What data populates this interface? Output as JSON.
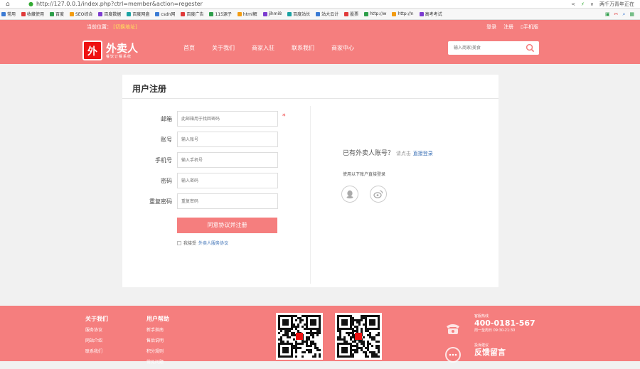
{
  "browser": {
    "url": "http://127.0.0.1/index.php?ctrl=member&action=regester",
    "right_text": "两千万青年正在",
    "bookmarks": [
      "常用",
      "收藏使用",
      "百度",
      "SEO综合",
      "百度数据",
      "百度网盘",
      "csdn网",
      "百度广告",
      "115源子",
      "html解",
      "jihmi8",
      "百度站长",
      "站大云计",
      "股票",
      "http://w",
      "http://n",
      "高考考试"
    ]
  },
  "header": {
    "location_label": "当前位置：",
    "location_city": "[切换地址]",
    "links": [
      "登录",
      "注册",
      "手机版"
    ],
    "logo_mark": "外",
    "logo_text": "外卖人",
    "logo_sub": "餐饮订餐系统",
    "nav": [
      "首页",
      "关于我们",
      "商家入驻",
      "联系我们",
      "商家中心"
    ],
    "search_placeholder": "输入商家/美食"
  },
  "register": {
    "title": "用户注册",
    "fields": [
      {
        "label": "邮箱",
        "placeholder": "此邮箱用于找回密码",
        "required": true
      },
      {
        "label": "账号",
        "placeholder": "输入账号",
        "required": false
      },
      {
        "label": "手机号",
        "placeholder": "输入手机号",
        "required": false
      },
      {
        "label": "密码",
        "placeholder": "输入密码",
        "required": false
      },
      {
        "label": "重复密码",
        "placeholder": "重复密码",
        "required": false
      }
    ],
    "required_mark": "*",
    "submit": "同意协议并注册",
    "agree_prefix": "我接受",
    "agree_link": "外卖人服务协议",
    "have_account": "已有外卖人账号？",
    "click_here": "请点击",
    "direct_login": "直接登录",
    "third_party": "使用以下账户直接登录"
  },
  "footer": {
    "col1": {
      "title": "关于我们",
      "items": [
        "服务协议",
        "网站介绍",
        "联系我们"
      ]
    },
    "col2": {
      "title": "用户帮助",
      "items": [
        "新手指南",
        "售后说明",
        "积分规则",
        "常见问题"
      ]
    },
    "phone_label": "客服热线",
    "phone": "400-0181-567",
    "hours": "周一至周日 09:30-21:30",
    "feedback_label": "投诉建议",
    "feedback": "反馈留言"
  },
  "colors": {
    "brand": "#f57e7e",
    "link": "#3a6fb5",
    "required": "#e33"
  }
}
